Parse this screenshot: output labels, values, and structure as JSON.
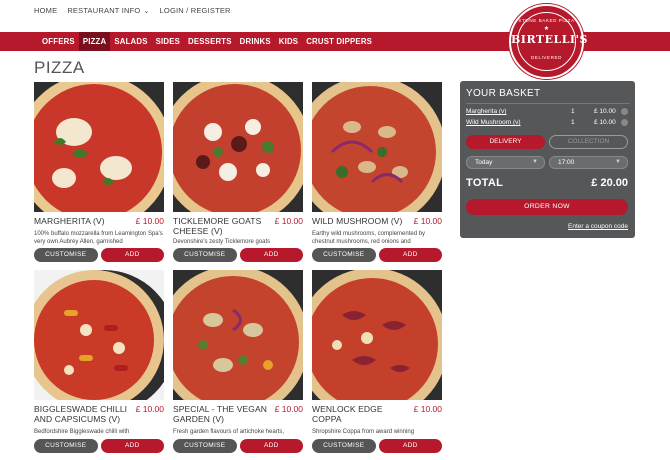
{
  "topnav": {
    "home": "HOME",
    "restaurant_info": "RESTAURANT INFO",
    "login": "LOGIN / REGISTER"
  },
  "categories": [
    "OFFERS",
    "PIZZA",
    "SALADS",
    "SIDES",
    "DESSERTS",
    "DRINKS",
    "KIDS",
    "CRUST DIPPERS"
  ],
  "active_category": "PIZZA",
  "logo": {
    "name": "BIRTELLI'S",
    "arc_top": "STONE BAKED PIZZA",
    "arc_bottom": "DELIVERED"
  },
  "page_title": "PIZZA",
  "buttons": {
    "customise": "CUSTOMISE",
    "add": "ADD"
  },
  "pizzas": [
    {
      "title": "MARGHERITA (V)",
      "price": "£ 10.00",
      "desc": "100% buffalo mozzarella from Leamington Spa's very own Aubrey Allen, garnished"
    },
    {
      "title": "TICKLEMORE GOATS CHEESE (V)",
      "price": "£ 10.00",
      "desc": "Devonshire's zesty Ticklemore goats"
    },
    {
      "title": "WILD MUSHROOM (V)",
      "price": "£ 10.00",
      "desc": "Earthy wild mushrooms, complemented by chestnut mushrooms, red onions and"
    },
    {
      "title": "BIGGLESWADE CHILLI AND CAPSICUMS (V)",
      "price": "£ 10.00",
      "desc": "Bedfordshire Biggleswade chilli with"
    },
    {
      "title": "SPECIAL - THE VEGAN GARDEN (V)",
      "price": "£ 10.00",
      "desc": "Fresh garden flavours of artichoke hearts,"
    },
    {
      "title": "WENLOCK EDGE COPPA",
      "price": "£ 10.00",
      "desc": "Shropshire Coppa from award winning"
    }
  ],
  "basket": {
    "title": "YOUR BASKET",
    "items": [
      {
        "name": "Margherita (v)",
        "qty": "1",
        "price": "£ 10.00"
      },
      {
        "name": "Wild Mushroom (v)",
        "qty": "1",
        "price": "£ 10.00"
      }
    ],
    "delivery": "DELIVERY",
    "collection": "COLLECTION",
    "day": "Today",
    "time": "17:00",
    "total_label": "TOTAL",
    "total_value": "£ 20.00",
    "order_now": "ORDER NOW",
    "coupon": "Enter a coupon code"
  },
  "colors": {
    "brand_red": "#b5192b",
    "active_tab": "#7c0f1d",
    "basket_bg": "#555759"
  }
}
